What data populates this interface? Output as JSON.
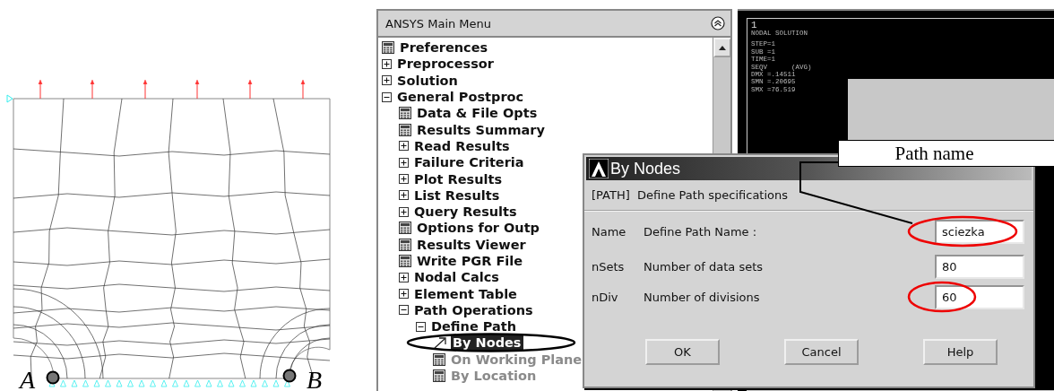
{
  "figure": {
    "labels": [
      "A",
      "B"
    ]
  },
  "menu": {
    "title": "ANSYS Main Menu",
    "items": [
      {
        "label": "Preferences",
        "kind": "action",
        "selected": false,
        "disabled": false
      },
      {
        "label": "Preprocessor",
        "kind": "group",
        "expanded": false,
        "selected": false,
        "disabled": false
      },
      {
        "label": "Solution",
        "kind": "group",
        "expanded": false,
        "selected": false,
        "disabled": false
      },
      {
        "label": "General Postproc",
        "kind": "group",
        "expanded": true,
        "selected": false,
        "disabled": false,
        "children": [
          {
            "label": "Data & File Opts",
            "kind": "action",
            "selected": false,
            "disabled": false
          },
          {
            "label": "Results Summary",
            "kind": "action",
            "selected": false,
            "disabled": false
          },
          {
            "label": "Read Results",
            "kind": "group",
            "expanded": false,
            "selected": false,
            "disabled": false
          },
          {
            "label": "Failure Criteria",
            "kind": "group",
            "expanded": false,
            "selected": false,
            "disabled": false
          },
          {
            "label": "Plot Results",
            "kind": "group",
            "expanded": false,
            "selected": false,
            "disabled": false
          },
          {
            "label": "List Results",
            "kind": "group",
            "expanded": false,
            "selected": false,
            "disabled": false
          },
          {
            "label": "Query Results",
            "kind": "group",
            "expanded": false,
            "selected": false,
            "disabled": false
          },
          {
            "label": "Options for Outp",
            "kind": "action",
            "selected": false,
            "disabled": false
          },
          {
            "label": "Results Viewer",
            "kind": "action",
            "selected": false,
            "disabled": false
          },
          {
            "label": "Write PGR File",
            "kind": "action",
            "selected": false,
            "disabled": false
          },
          {
            "label": "Nodal Calcs",
            "kind": "group",
            "expanded": false,
            "selected": false,
            "disabled": false
          },
          {
            "label": "Element Table",
            "kind": "group",
            "expanded": false,
            "selected": false,
            "disabled": false
          },
          {
            "label": "Path Operations",
            "kind": "group",
            "expanded": true,
            "selected": false,
            "disabled": false,
            "children": [
              {
                "label": "Define Path",
                "kind": "group",
                "expanded": true,
                "selected": false,
                "disabled": false,
                "children": [
                  {
                    "label": "By Nodes",
                    "kind": "pick",
                    "selected": true,
                    "disabled": false
                  },
                  {
                    "label": "On Working Plane",
                    "kind": "action",
                    "selected": false,
                    "disabled": true
                  },
                  {
                    "label": "By Location",
                    "kind": "action",
                    "selected": false,
                    "disabled": true
                  }
                ]
              }
            ]
          }
        ]
      }
    ]
  },
  "graphics": {
    "window_number": "1",
    "lines": [
      "NODAL SOLUTION",
      "STEP=1",
      "SUB =1",
      "TIME=1",
      "SEQV      (AVG)",
      "DMX =.14511",
      "SMN =.20695",
      "SMX =76.519"
    ]
  },
  "dialog": {
    "title": "By Nodes",
    "subtitle": "[PATH]  Define Path specifications",
    "fields": [
      {
        "code": "Name",
        "label": "Define Path Name :",
        "value": "sciezka",
        "highlighted": true
      },
      {
        "code": "nSets",
        "label": "Number of data sets",
        "value": "80",
        "highlighted": false
      },
      {
        "code": "nDiv",
        "label": "Number of divisions",
        "value": "60",
        "highlighted": true
      }
    ],
    "buttons": [
      "OK",
      "Cancel",
      "Help"
    ]
  },
  "callout": {
    "text": "Path name"
  }
}
